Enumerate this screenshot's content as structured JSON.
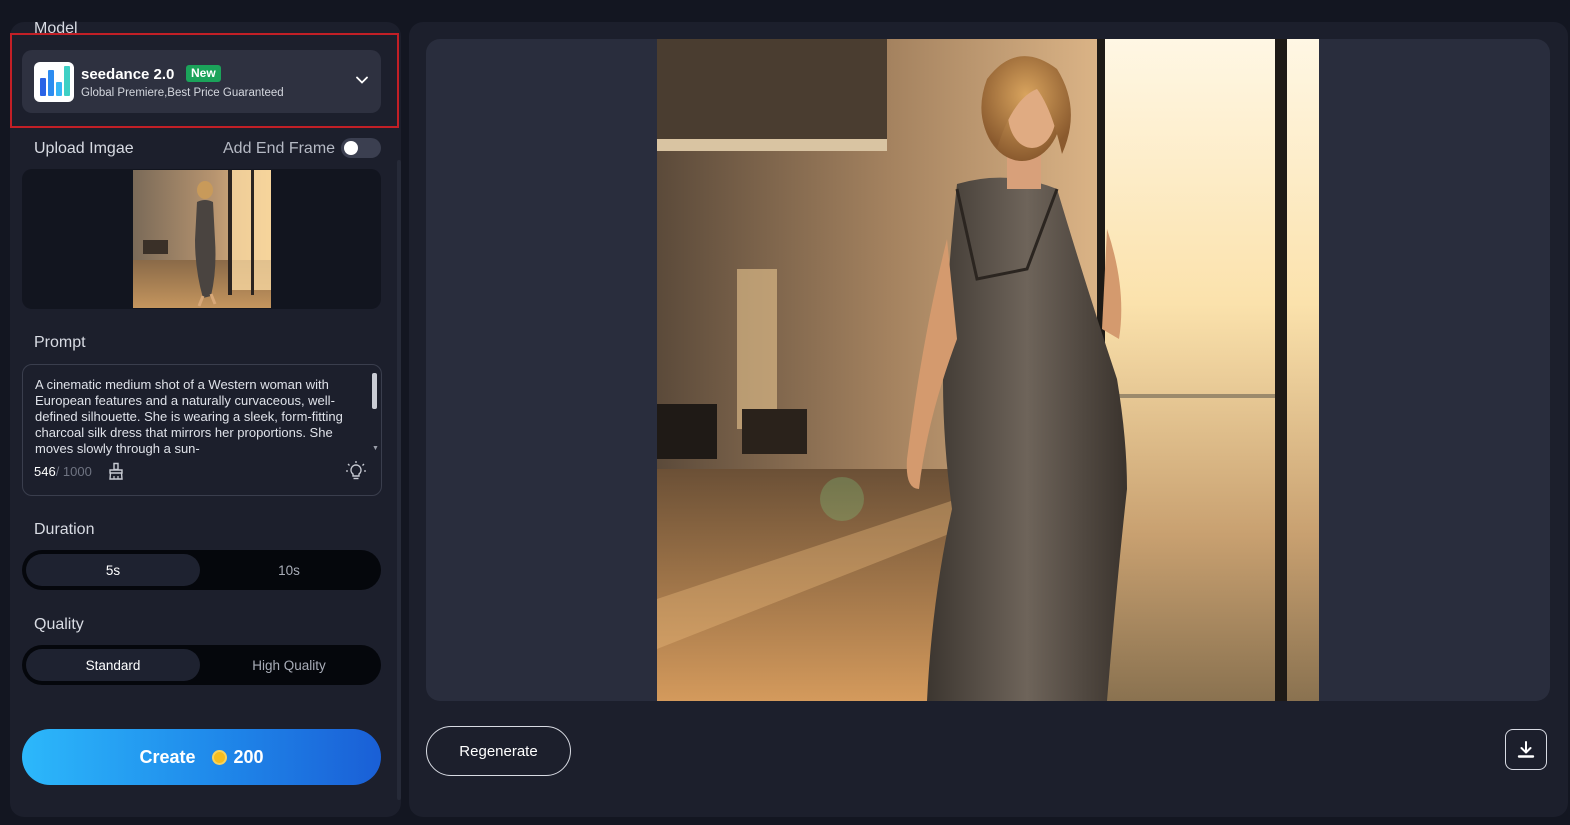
{
  "model": {
    "section_label": "Model",
    "name": "seedance 2.0",
    "badge": "New",
    "description": "Global Premiere,Best Price Guaranteed",
    "logo_icon": "bar-chart-logo-icon",
    "dropdown_icon": "chevron-down-icon"
  },
  "upload": {
    "label": "Upload Imgae",
    "end_frame_label": "Add End Frame",
    "end_frame_enabled": false
  },
  "prompt": {
    "label": "Prompt",
    "text": "A cinematic medium shot of a Western woman with European features and a naturally curvaceous, well-defined silhouette. She is wearing a sleek, form-fitting charcoal silk dress that mirrors her proportions. She moves slowly through a sun-",
    "char_count": "546",
    "char_max": "/ 1000",
    "clear_icon": "brush-icon",
    "enhance_icon": "lightbulb-icon"
  },
  "duration": {
    "label": "Duration",
    "options": [
      "5s",
      "10s"
    ],
    "selected": "5s"
  },
  "quality": {
    "label": "Quality",
    "options": [
      "Standard",
      "High Quality"
    ],
    "selected": "Standard"
  },
  "create": {
    "label": "Create",
    "cost": "200",
    "coin_icon": "coin-icon"
  },
  "actions": {
    "regenerate_label": "Regenerate",
    "download_icon": "download-icon"
  },
  "colors": {
    "accent_start": "#2cb8fb",
    "accent_end": "#1a5fd6",
    "badge_green": "#1ba35a",
    "highlight_red": "#c21f26"
  }
}
